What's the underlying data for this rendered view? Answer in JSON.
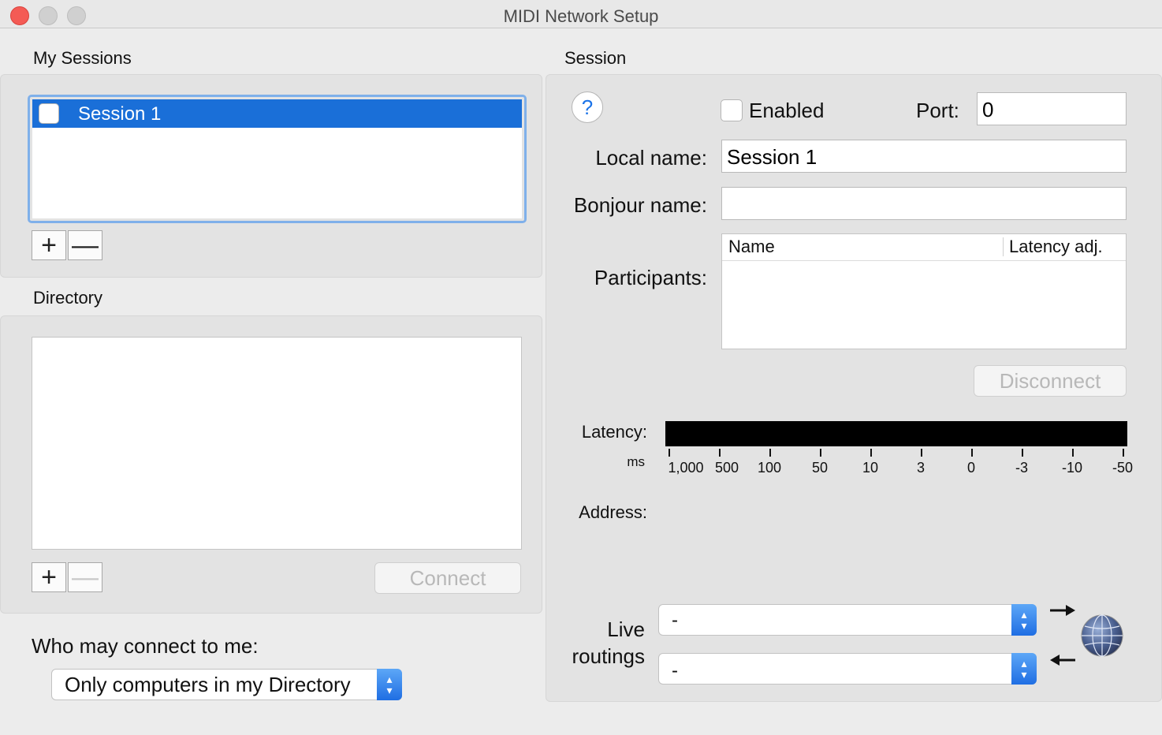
{
  "window": {
    "title": "MIDI Network Setup"
  },
  "my_sessions": {
    "heading": "My Sessions",
    "items": [
      {
        "label": "Session 1",
        "checked": false,
        "selected": true
      }
    ],
    "add_label": "+",
    "remove_label": "—"
  },
  "directory": {
    "heading": "Directory",
    "add_label": "+",
    "remove_label": "—",
    "connect_label": "Connect"
  },
  "who_may_connect": {
    "label": "Who may connect to me:",
    "selected": "Only computers in my Directory"
  },
  "session": {
    "heading": "Session",
    "help_label": "?",
    "enabled_label": "Enabled",
    "enabled": false,
    "port_label": "Port:",
    "port_value": "0",
    "local_name_label": "Local name:",
    "local_name_value": "Session 1",
    "bonjour_name_label": "Bonjour name:",
    "bonjour_name_value": "",
    "participants_label": "Participants:",
    "participants_columns": [
      "Name",
      "Latency adj."
    ],
    "disconnect_label": "Disconnect",
    "latency_label": "Latency:",
    "latency_unit": "ms",
    "latency_ticks": [
      "1,000",
      "500",
      "100",
      "50",
      "10",
      "3",
      "0",
      "-3",
      "-10",
      "-50"
    ],
    "address_label": "Address:",
    "live_routings_label_1": "Live",
    "live_routings_label_2": "routings",
    "routing_in_value": "-",
    "routing_out_value": "-"
  },
  "colors": {
    "selection": "#1a6fd8",
    "close_button": "#f45b55",
    "accent": "#1f6ee3"
  },
  "icons": {
    "network": "globe-icon",
    "arrow_right": "arrow-right-icon",
    "arrow_left": "arrow-left-icon"
  }
}
